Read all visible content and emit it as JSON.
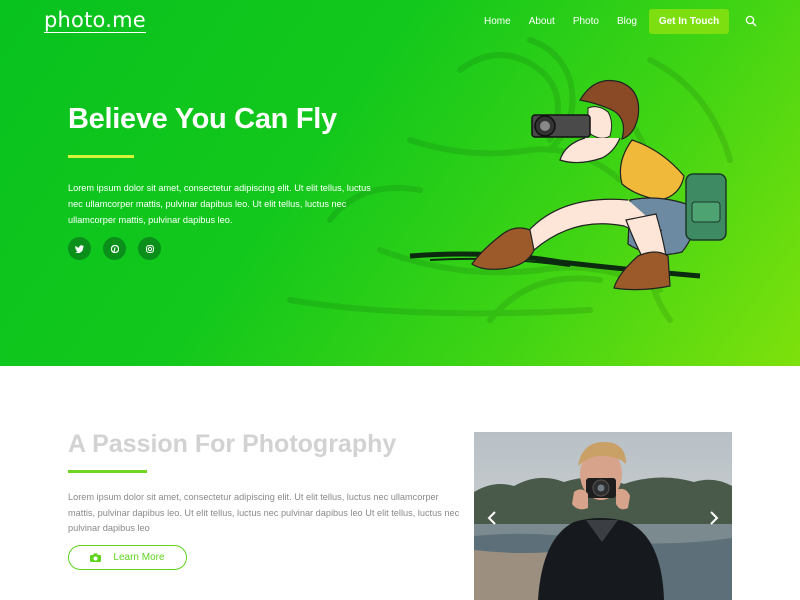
{
  "brand": {
    "logo": "photo.me"
  },
  "nav": {
    "links": [
      "Home",
      "About",
      "Photo",
      "Blog"
    ],
    "cta": "Get In Touch",
    "search_icon": "search-icon"
  },
  "hero": {
    "title": "Believe You Can Fly",
    "text": "Lorem ipsum dolor sit amet, consectetur adipiscing elit. Ut elit tellus, luctus nec ullamcorper mattis, pulvinar dapibus leo. Ut elit tellus, luctus nec ullamcorper mattis, pulvinar dapibus leo.",
    "socials": [
      "twitter-icon",
      "pinterest-icon",
      "instagram-icon"
    ]
  },
  "about": {
    "title": "A Passion For Photography",
    "text": "Lorem ipsum dolor sit amet, consectetur adipiscing elit. Ut elit tellus, luctus nec ullamcorper mattis, pulvinar dapibus leo. Ut elit tellus, luctus nec  pulvinar dapibus leo Ut elit tellus, luctus nec  pulvinar dapibus leo",
    "button": "Learn More"
  },
  "colors": {
    "accent": "#7ddf10",
    "hero_start": "#08c21e",
    "hero_end": "#7ee10c",
    "button_outline": "#5ed41c"
  }
}
